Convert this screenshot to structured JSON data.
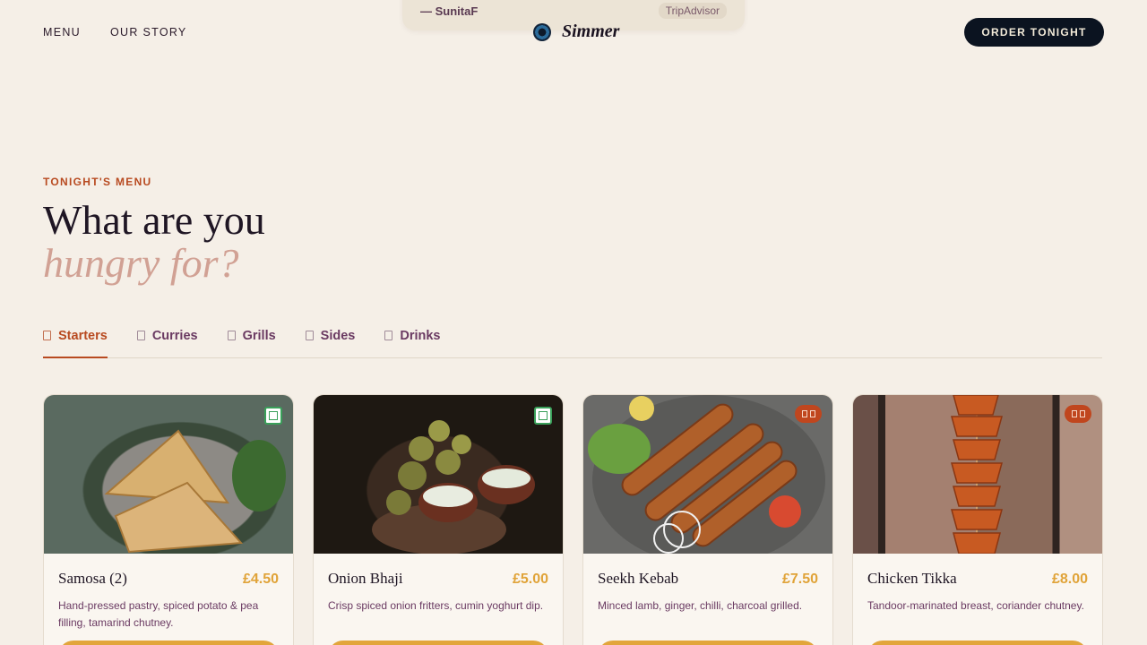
{
  "review": {
    "author": "— SunitaF",
    "source": "TripAdvisor"
  },
  "header": {
    "nav": [
      "MENU",
      "OUR STORY"
    ],
    "brand": "Simmer",
    "cta": "ORDER TONIGHT"
  },
  "section": {
    "eyebrow": "TONIGHT'S MENU",
    "title_line1": "What are you",
    "title_line2": "hungry for?"
  },
  "tabs": [
    {
      "label": "Starters",
      "active": true
    },
    {
      "label": "Curries",
      "active": false
    },
    {
      "label": "Grills",
      "active": false
    },
    {
      "label": "Sides",
      "active": false
    },
    {
      "label": "Drinks",
      "active": false
    }
  ],
  "items": [
    {
      "name": "Samosa (2)",
      "price": "£4.50",
      "desc": "Hand-pressed pastry, spiced potato & pea filling, tamarind chutney.",
      "badge": "veg"
    },
    {
      "name": "Onion Bhaji",
      "price": "£5.00",
      "desc": "Crisp spiced onion fritters, cumin yoghurt dip.",
      "badge": "veg"
    },
    {
      "name": "Seekh Kebab",
      "price": "£7.50",
      "desc": "Minced lamb, ginger, chilli, charcoal grilled.",
      "badge": "spicy"
    },
    {
      "name": "Chicken Tikka",
      "price": "£8.00",
      "desc": "Tandoor-marinated breast, coriander chutney.",
      "badge": "spicy"
    }
  ],
  "colors": {
    "accent": "#b84a20",
    "price": "#e0a338",
    "cta_bg": "#0b1320",
    "bg": "#f5efe7"
  }
}
